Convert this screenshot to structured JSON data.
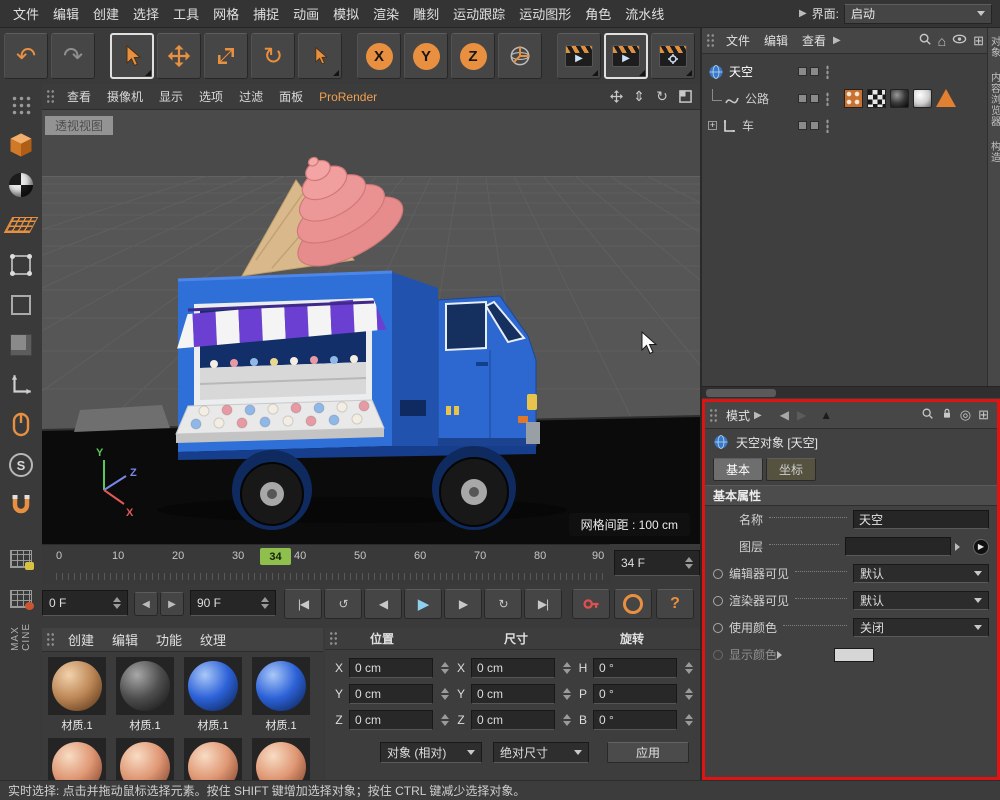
{
  "menubar": {
    "items": [
      "文件",
      "编辑",
      "创建",
      "选择",
      "工具",
      "网格",
      "捕捉",
      "动画",
      "模拟",
      "渲染",
      "雕刻",
      "运动跟踪",
      "运动图形",
      "角色",
      "流水线"
    ],
    "interface_label": "界面:",
    "interface_value": "启动"
  },
  "toolbar": {
    "axis_x": "X",
    "axis_y": "Y",
    "axis_z": "Z"
  },
  "viewport": {
    "menu": [
      "查看",
      "摄像机",
      "显示",
      "选项",
      "过滤",
      "面板"
    ],
    "prorender": "ProRender",
    "view_label": "透视视图",
    "grid_label": "网格间距 : 100 cm",
    "axis": {
      "x": "X",
      "y": "Y",
      "z": "Z"
    }
  },
  "timeline": {
    "ticks": [
      "0",
      "10",
      "20",
      "30",
      "40",
      "50",
      "60",
      "70",
      "80",
      "90"
    ],
    "current": "34",
    "frame_field": "34 F",
    "start_field": "0 F",
    "end_field": "90 F"
  },
  "materials": {
    "menu": [
      "创建",
      "编辑",
      "功能",
      "纹理"
    ],
    "items": [
      {
        "label": "材质.1",
        "color": "#b5824f"
      },
      {
        "label": "材质.1",
        "color": "#555555"
      },
      {
        "label": "材质.1",
        "color": "#2d62d8"
      },
      {
        "label": "材质.1",
        "color": "#2d62d8"
      }
    ]
  },
  "coords": {
    "headers": [
      "位置",
      "尺寸",
      "旋转"
    ],
    "position_labels": [
      "X",
      "Y",
      "Z"
    ],
    "position_values": [
      "0 cm",
      "0 cm",
      "0 cm"
    ],
    "size_labels": [
      "X",
      "Y",
      "Z"
    ],
    "size_values": [
      "0 cm",
      "0 cm",
      "0 cm"
    ],
    "rotation_labels": [
      "H",
      "P",
      "B"
    ],
    "rotation_values": [
      "0 °",
      "0 °",
      "0 °"
    ],
    "space_dropdown": "对象 (相对)",
    "size_mode_dropdown": "绝对尺寸",
    "apply_label": "应用"
  },
  "object_manager": {
    "menu": [
      "文件",
      "编辑",
      "查看"
    ],
    "objects": [
      {
        "name": "天空"
      },
      {
        "name": "公路"
      },
      {
        "name": "车"
      }
    ]
  },
  "side_tabs": [
    "对象",
    "内容浏览器",
    "构造"
  ],
  "attributes": {
    "mode_label": "模式",
    "title": "天空对象 [天空]",
    "tabs": [
      "基本",
      "坐标"
    ],
    "section": "基本属性",
    "fields": {
      "name_label": "名称",
      "name_value": "天空",
      "layer_label": "图层",
      "editor_label": "编辑器可见",
      "editor_value": "默认",
      "renderer_label": "渲染器可见",
      "renderer_value": "默认",
      "color_label": "使用颜色",
      "color_value": "关闭",
      "display_color_label": "显示颜色"
    }
  },
  "status_bar": {
    "text": "实时选择: 点击并拖动鼠标选择元素。按住 SHIFT 键增加选择对象；按住 CTRL 键减少选择对象。"
  },
  "icons": {
    "s": "S",
    "question": "?"
  },
  "branding": [
    "MAX",
    "CINE"
  ],
  "colors": {
    "accent_orange": "#e89040",
    "highlight_red": "#e01212",
    "marker_green": "#8fbf4d",
    "truck_blue": "#2e6fd8",
    "play_blue": "#8fd0f0"
  }
}
